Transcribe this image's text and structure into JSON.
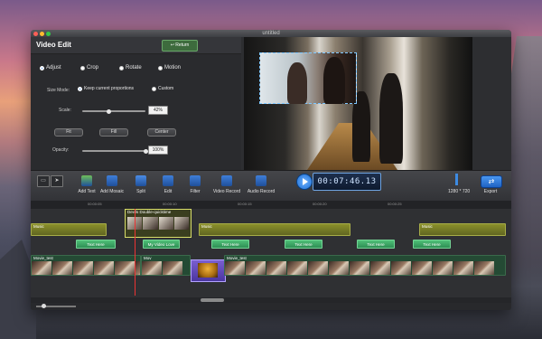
{
  "window": {
    "title": "untitled"
  },
  "edit_panel": {
    "title": "Video Edit",
    "return_label": "Return",
    "tabs": [
      "Adjust",
      "Crop",
      "Rotate",
      "Motion"
    ],
    "size_mode_label": "Size Mode:",
    "size_mode_options": [
      "Keep current proportions",
      "Custom"
    ],
    "scale_label": "Scale:",
    "scale_value": "42%",
    "scale_fraction": 0.42,
    "buttons": [
      "Fit",
      "Fill",
      "Center"
    ],
    "opacity_label": "Opacity:",
    "opacity_value": "100%",
    "opacity_fraction": 1.0
  },
  "toolbar": {
    "tools": [
      {
        "label": "Add Text",
        "icon": "add-text-icon",
        "color": "#6fbf5a"
      },
      {
        "label": "Add Mosaic",
        "icon": "mosaic-icon",
        "color": "#3f7fd9"
      },
      {
        "label": "Split",
        "icon": "split-icon",
        "color": "#4b8de6"
      },
      {
        "label": "Edit",
        "icon": "edit-icon",
        "color": "#3f7fd9"
      },
      {
        "label": "Filter",
        "icon": "filter-icon",
        "color": "#3f7fd9"
      },
      {
        "label": "Video Record",
        "icon": "video-record-icon",
        "color": "#3f7fd9"
      },
      {
        "label": "Audio Record",
        "icon": "microphone-icon",
        "color": "#3f7fd9"
      }
    ],
    "timecode": "00:07:46.13",
    "resolution": "1280 * 720",
    "export_label": "Export"
  },
  "timeline": {
    "ruler_ticks": [
      "00:00:05",
      "00:00:10",
      "00:00:15",
      "00:00:20",
      "00:00:25"
    ],
    "split_clip_label": "Devils Double-quicktime",
    "music_label": "Music",
    "text_clips": [
      "Text Here",
      "My Video Love",
      "Text Here",
      "Text Here",
      "Text Here",
      "Text Here"
    ],
    "movie_label": "Movie_test",
    "movie_label_short": "Mov"
  }
}
